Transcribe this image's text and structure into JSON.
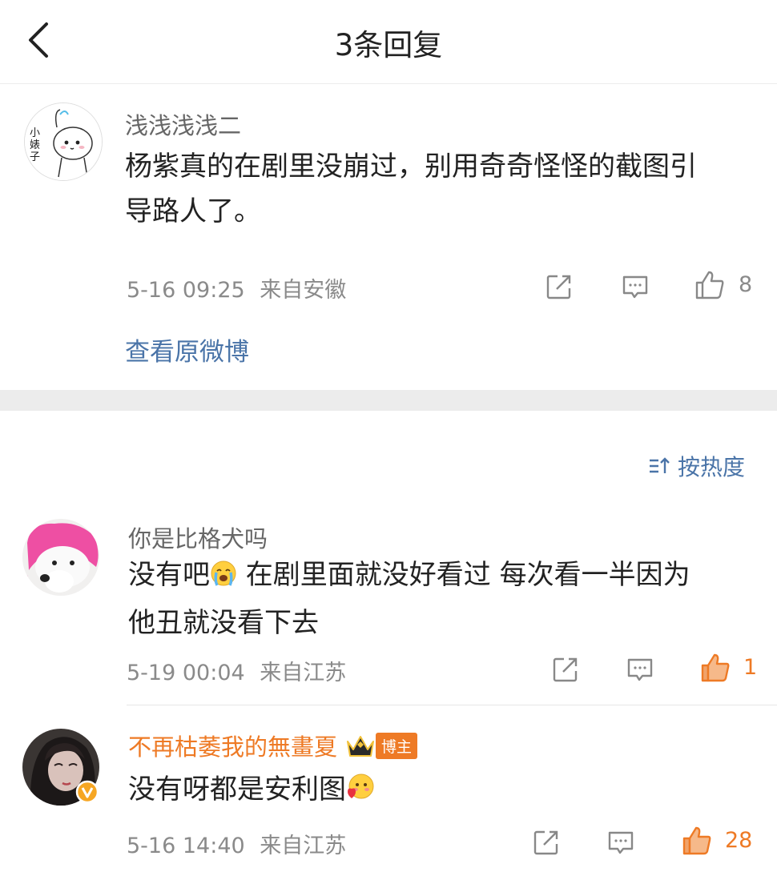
{
  "header": {
    "title": "3条回复"
  },
  "main_comment": {
    "username": "浅浅浅浅二",
    "avatar_text": "小婊子",
    "text_line1": "杨紫真的在剧里没崩过，别用奇奇怪怪的截图引",
    "text_line2": "导路人了。",
    "time": "5-16 09:25",
    "location": "来自安徽",
    "likes": "8",
    "view_original": "查看原微博"
  },
  "sort": {
    "label": "按热度"
  },
  "replies": [
    {
      "username": "你是比格犬吗",
      "text_part1": "没有吧",
      "emoji": "crying-face-emoji",
      "text_part2": " 在剧里面就没好看过 每次看一半因为",
      "text_line2": "他丑就没看下去",
      "time": "5-19 00:04",
      "location": "来自江苏",
      "likes": "1"
    },
    {
      "username": "不再枯萎我的無畫夏",
      "badge": "博主",
      "text": "没有呀都是安利图",
      "emoji": "heart-face-emoji",
      "time": "5-16 14:40",
      "location": "来自江苏",
      "likes": "28"
    }
  ],
  "colors": {
    "accent": "#ee7a25",
    "link": "#4a74a8",
    "muted": "#8a8a8a"
  }
}
